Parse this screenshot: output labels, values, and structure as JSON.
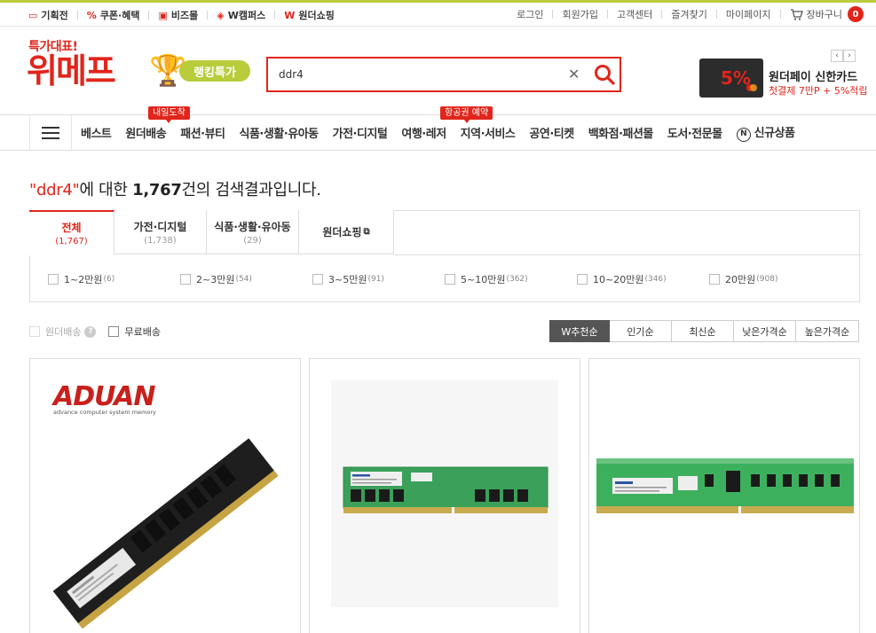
{
  "util_left": [
    {
      "icon": "calendar-icon",
      "label": "기획전"
    },
    {
      "icon": "percent-coupon-icon",
      "label": "쿠폰·혜택"
    },
    {
      "icon": "store-icon",
      "label": "비즈몰"
    },
    {
      "icon": "graduation-cap-icon",
      "label": "W캠퍼스"
    },
    {
      "icon": "wonder-w-icon",
      "label": "원더쇼핑"
    }
  ],
  "util_right": [
    "로그인",
    "회원가입",
    "고객센터",
    "즐겨찾기",
    "마이페이지"
  ],
  "cart": {
    "label": "장바구니",
    "count": "0",
    "icon": "cart-icon"
  },
  "header": {
    "logo_tag": "특가대표!",
    "logo": "위메프",
    "ranking_label": "랭킹특가",
    "ranking_icon": "trophy-icon"
  },
  "search": {
    "query": "ddr4",
    "clear_icon": "close-icon",
    "search_icon": "search-icon"
  },
  "promo": {
    "title": "원더페이 신한카드",
    "subtitle": "첫결제 7만P + 5%적립",
    "card_text": "5%"
  },
  "nav": {
    "items": [
      "베스트",
      "원더배송",
      "패션·뷰티",
      "식품·생활·유아동",
      "가전·디지털",
      "여행·레저",
      "지역·서비스",
      "공연·티켓",
      "백화점·패션몰",
      "도서·전문몰",
      "신규상품"
    ],
    "new_icon_text": "N",
    "badge_delivery": "내일도착",
    "badge_travel": "항공권 예약"
  },
  "result": {
    "open_quote": "\"",
    "query": "ddr4",
    "close_quote": "\"",
    "pre": "에 대한 ",
    "count": "1,767",
    "post": "건의 검색결과입니다."
  },
  "tabs": [
    {
      "label": "전체",
      "count": "(1,767)"
    },
    {
      "label": "가전·디지털",
      "count": "(1,738)"
    },
    {
      "label": "식품·생활·유아동",
      "count": "(29)"
    },
    {
      "label": "원더쇼핑",
      "count": ""
    }
  ],
  "price_filters": [
    {
      "label": "1~2만원",
      "count": "(6)"
    },
    {
      "label": "2~3만원",
      "count": "(54)"
    },
    {
      "label": "3~5만원",
      "count": "(91)"
    },
    {
      "label": "5~10만원",
      "count": "(362)"
    },
    {
      "label": "10~20만원",
      "count": "(346)"
    },
    {
      "label": "20만원",
      "count": "(908)"
    }
  ],
  "filters": {
    "wonder_delivery": "원더배송",
    "help": "?",
    "free_shipping": "무료배송"
  },
  "sorts": [
    "W추천순",
    "인기순",
    "최신순",
    "낮은가격순",
    "높은가격순"
  ],
  "products": [
    {
      "brand": "ADUAN",
      "brand_sub": "advance computer system memory"
    },
    {
      "brand": "",
      "brand_sub": ""
    },
    {
      "brand": "",
      "brand_sub": ""
    }
  ],
  "colors": {
    "accent": "#e1251b",
    "lime": "#b8cc3c",
    "pcb_green": "#3aa05a"
  }
}
